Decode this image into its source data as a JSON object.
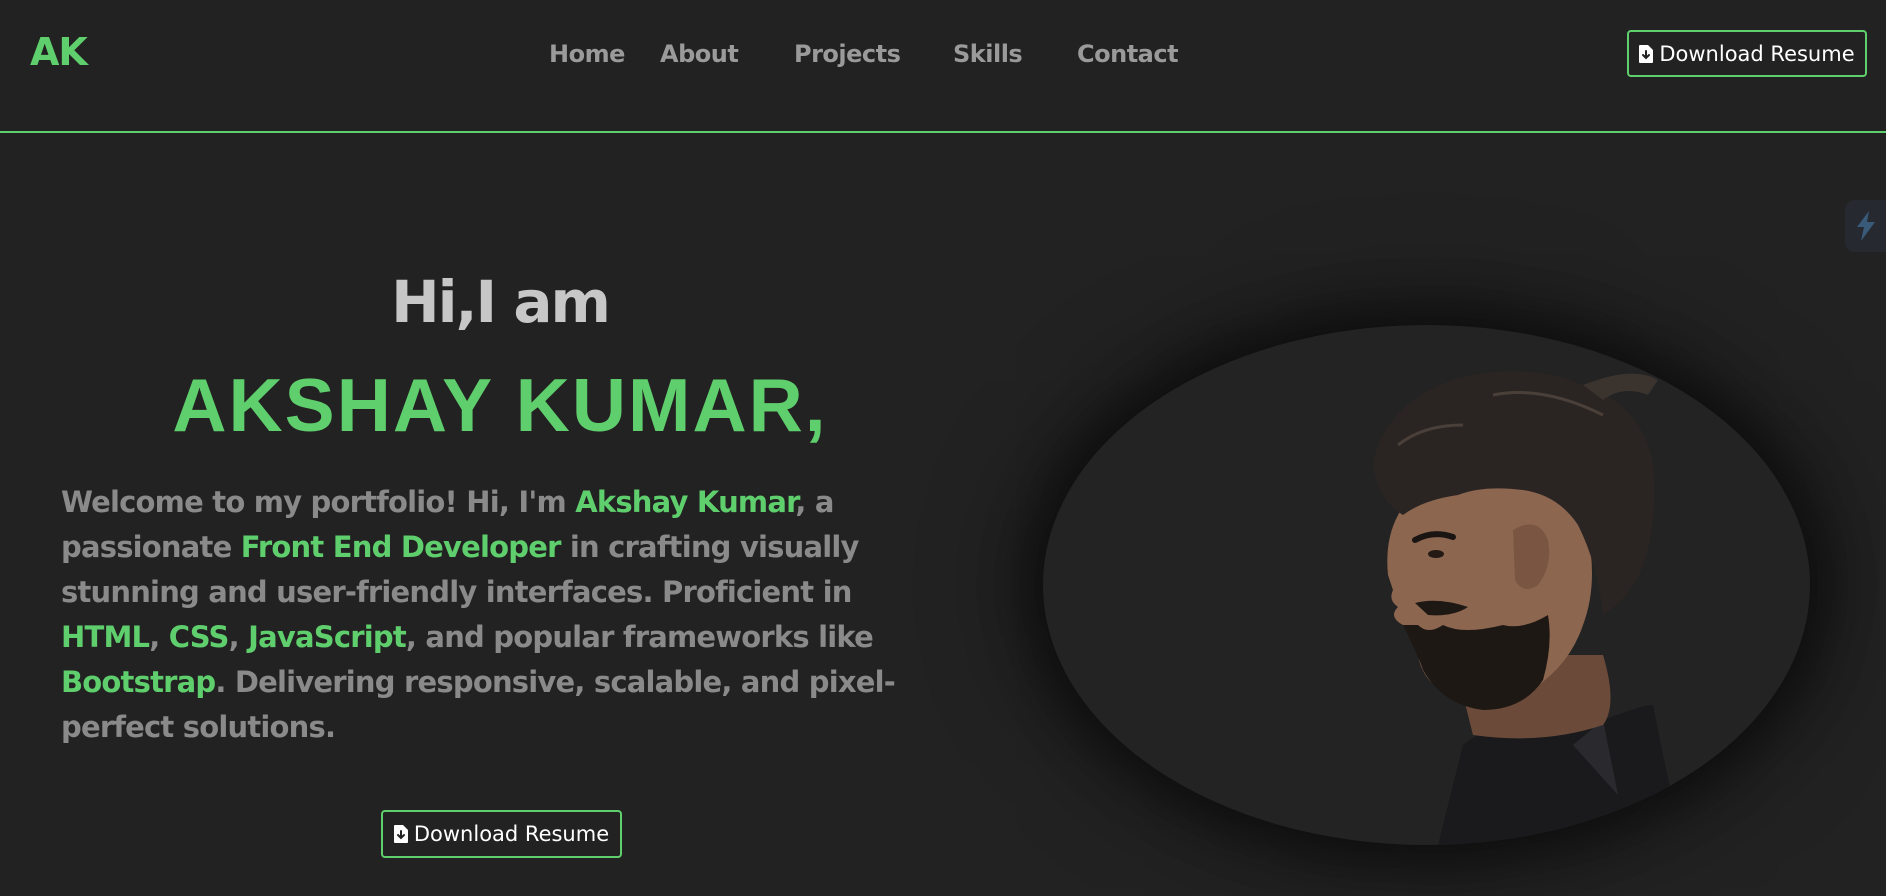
{
  "nav": {
    "logo": "AK",
    "links": [
      "Home",
      "About",
      "Projects",
      "Skills",
      "Contact"
    ],
    "resume_button": "Download Resume"
  },
  "hero": {
    "greeting": "Hi,I am",
    "name": "AKSHAY KUMAR,",
    "description": {
      "t1": "Welcome to my portfolio! Hi, I'm ",
      "h1": "Akshay Kumar",
      "t2": ", a passionate ",
      "h2": "Front End Developer",
      "t3": " in crafting visually stunning and user-friendly interfaces. Proficient in ",
      "h3": "HTML",
      "t4": ", ",
      "h4": "CSS",
      "t5": ", ",
      "h5": "JavaScript",
      "t6": ", and popular frameworks like ",
      "h6": "Bootstrap",
      "t7": ". Delivering responsive, scalable, and pixel-perfect solutions."
    },
    "resume_button": "Download Resume"
  },
  "icons": {
    "resume": "file-download-icon",
    "side_widget": "bolt-icon",
    "portrait": "profile-photo"
  },
  "colors": {
    "background": "#222222",
    "accent": "#5fcf6d",
    "text_muted": "#8a8a8a",
    "nav_text": "#9a9a9a",
    "greeting": "#c7c7c7"
  }
}
